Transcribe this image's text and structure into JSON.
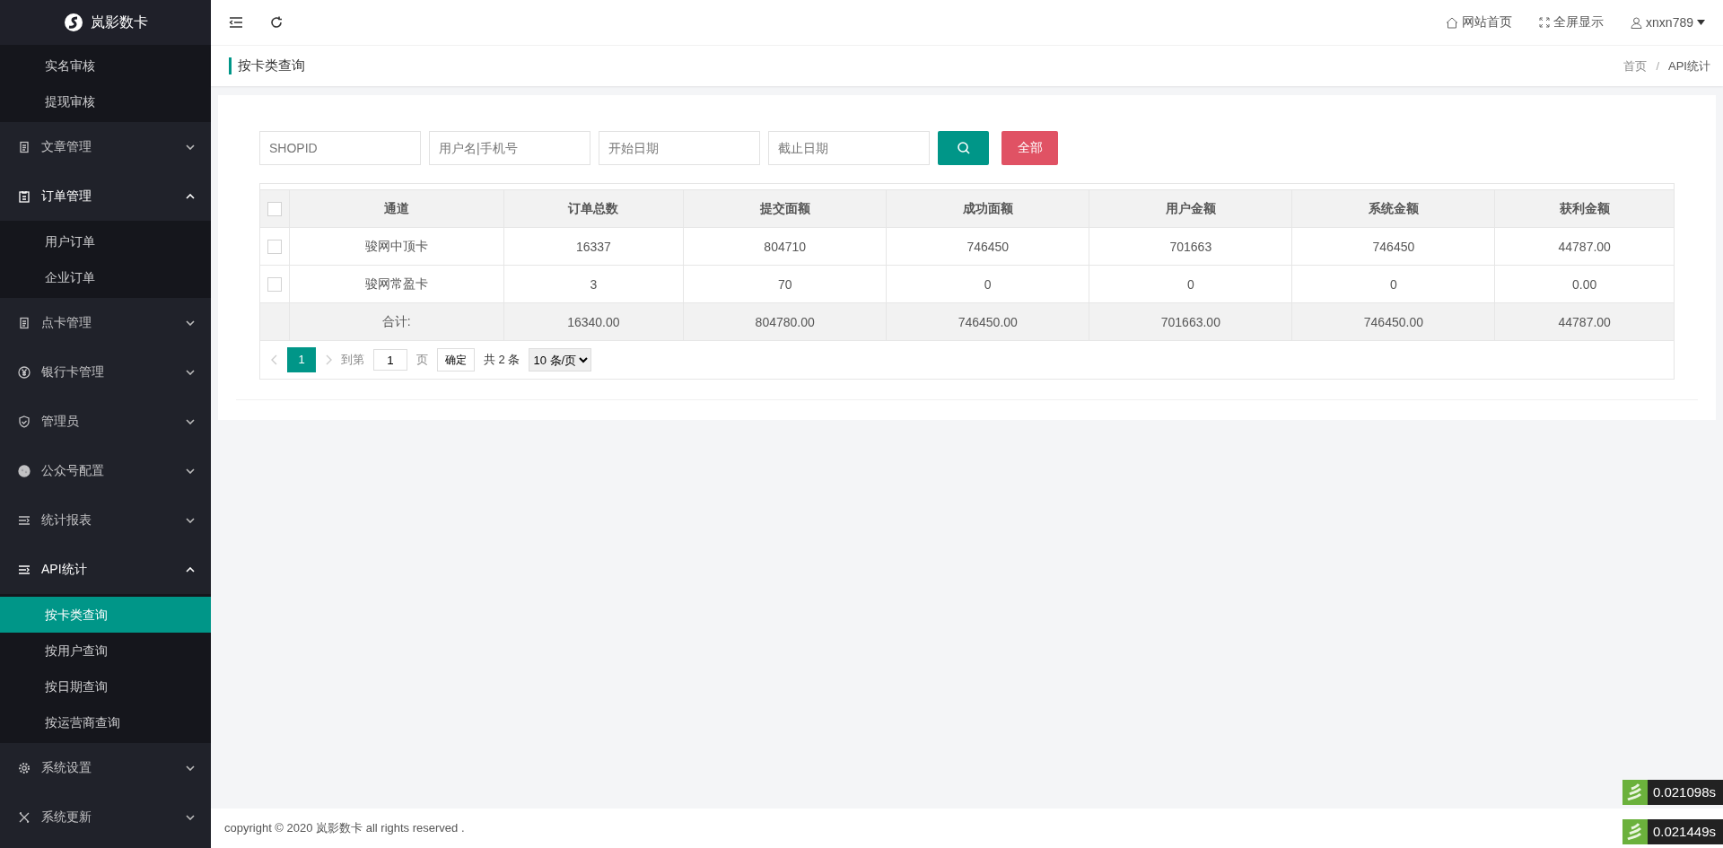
{
  "sidebar": {
    "logo": "岚影数卡",
    "items": [
      {
        "kind": "group",
        "children": [
          {
            "label": "实名审核",
            "selected": false
          },
          {
            "label": "提现审核",
            "selected": false
          }
        ]
      },
      {
        "kind": "menu",
        "label": "文章管理",
        "expanded": false
      },
      {
        "kind": "menu",
        "label": "订单管理",
        "expanded": true,
        "children": [
          {
            "label": "用户订单",
            "selected": false
          },
          {
            "label": "企业订单",
            "selected": false
          }
        ]
      },
      {
        "kind": "menu",
        "label": "点卡管理",
        "expanded": false
      },
      {
        "kind": "menu",
        "label": "银行卡管理",
        "expanded": false
      },
      {
        "kind": "menu",
        "label": "管理员",
        "expanded": false
      },
      {
        "kind": "menu",
        "label": "公众号配置",
        "expanded": false
      },
      {
        "kind": "menu",
        "label": "统计报表",
        "expanded": false
      },
      {
        "kind": "menu",
        "label": "API统计",
        "expanded": true,
        "children": [
          {
            "label": "按卡类查询",
            "selected": true
          },
          {
            "label": "按用户查询",
            "selected": false
          },
          {
            "label": "按日期查询",
            "selected": false
          },
          {
            "label": "按运营商查询",
            "selected": false
          }
        ]
      },
      {
        "kind": "menu",
        "label": "系统设置",
        "expanded": false
      },
      {
        "kind": "menu",
        "label": "系统更新",
        "expanded": false
      }
    ]
  },
  "topbar": {
    "links": [
      "网站首页",
      "全屏显示"
    ],
    "user": "xnxn789"
  },
  "page_title": "按卡类查询",
  "breadcrumb": [
    "首页",
    "API统计"
  ],
  "breadcrumb_separator": "/",
  "filters": {
    "fields": [
      {
        "placeholder": "SHOPID"
      },
      {
        "placeholder": "用户名|手机号"
      },
      {
        "placeholder": "开始日期"
      },
      {
        "placeholder": "截止日期"
      }
    ],
    "all_button": "全部"
  },
  "table": {
    "header_checked": false,
    "columns": [
      "通道",
      "订单总数",
      "提交面额",
      "成功面额",
      "用户金额",
      "系统金额",
      "获利金额"
    ],
    "rows": [
      {
        "checked": false,
        "cells": [
          "骏网中顶卡",
          "16337",
          "804710",
          "746450",
          "701663",
          "746450",
          "44787.00"
        ]
      },
      {
        "checked": false,
        "cells": [
          "骏网常盈卡",
          "3",
          "70",
          "0",
          "0",
          "0",
          "0.00"
        ]
      }
    ],
    "total": [
      "合计:",
      "16340.00",
      "804780.00",
      "746450.00",
      "701663.00",
      "746450.00",
      "44787.00"
    ]
  },
  "pagination": {
    "pages": [
      {
        "label": "1",
        "selected": true
      }
    ],
    "goto_label": "到第",
    "goto_value": "1",
    "page_unit": "页",
    "confirm": "确定",
    "count": "共 2 条",
    "page_size": "10 条/页"
  },
  "footer": "copyright © 2020 岚影数卡 all rights reserved .",
  "timings": [
    "0.021098s",
    "0.021449s"
  ]
}
